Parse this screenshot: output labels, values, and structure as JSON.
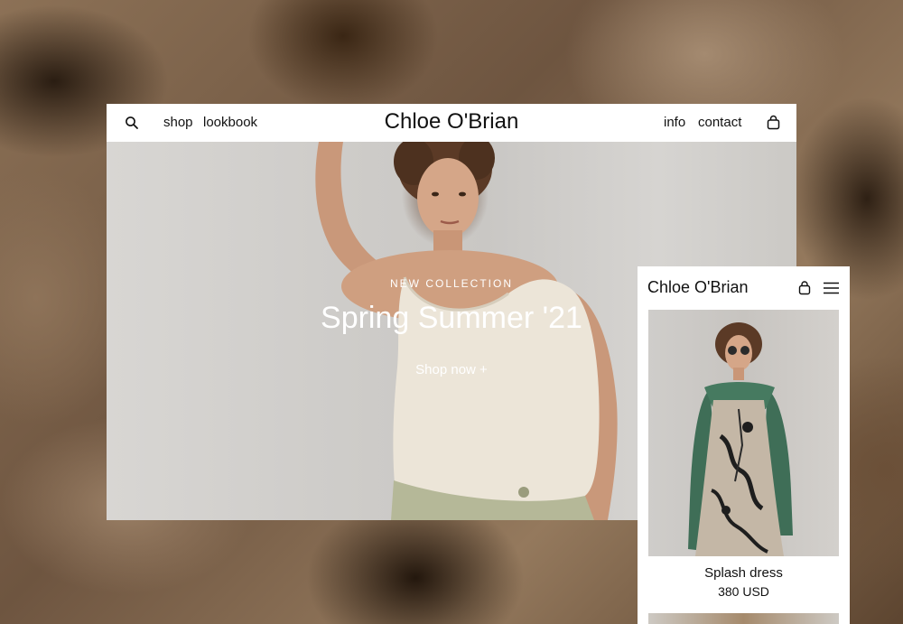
{
  "desktop": {
    "header": {
      "brand": "Chloe O'Brian",
      "nav_left": [
        "shop",
        "lookbook"
      ],
      "nav_right": [
        "info",
        "contact"
      ]
    },
    "hero": {
      "eyebrow": "NEW COLLECTION",
      "title": "Spring Summer '21",
      "cta": "Shop now +"
    }
  },
  "mobile": {
    "brand": "Chloe O'Brian",
    "product": {
      "name": "Splash dress",
      "price": "380 USD"
    }
  },
  "colors": {
    "text": "#111111",
    "hero_text": "#ffffff",
    "window_bg": "#ffffff",
    "coat_green": "#3f6e57",
    "skirt_sage": "#b5b898",
    "top_cream": "#ece5d8"
  },
  "icons": [
    "search-icon",
    "bag-icon",
    "menu-icon"
  ]
}
